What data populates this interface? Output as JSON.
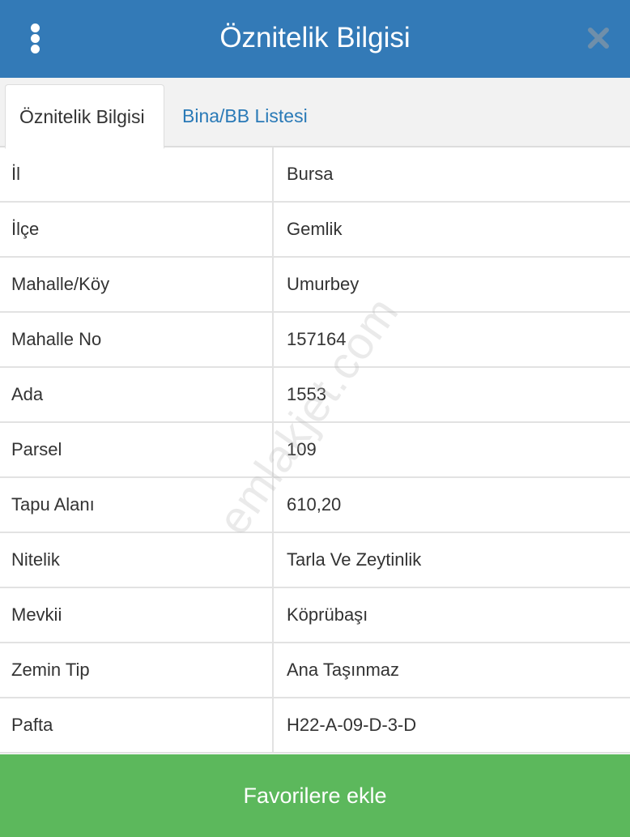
{
  "header": {
    "title": "Öznitelik Bilgisi",
    "menu_icon": "more-vertical-icon",
    "close_icon": "close-icon",
    "color": "#337ab7"
  },
  "tabs": [
    {
      "label": "Öznitelik Bilgisi",
      "active": true
    },
    {
      "label": "Bina/BB Listesi",
      "active": false
    }
  ],
  "attributes": [
    {
      "label": "İl",
      "value": "Bursa"
    },
    {
      "label": "İlçe",
      "value": "Gemlik"
    },
    {
      "label": "Mahalle/Köy",
      "value": "Umurbey"
    },
    {
      "label": "Mahalle No",
      "value": "157164"
    },
    {
      "label": "Ada",
      "value": "1553"
    },
    {
      "label": "Parsel",
      "value": "109"
    },
    {
      "label": "Tapu Alanı",
      "value": "610,20"
    },
    {
      "label": "Nitelik",
      "value": "Tarla Ve Zeytinlik"
    },
    {
      "label": "Mevkii",
      "value": "Köprübaşı"
    },
    {
      "label": "Zemin Tip",
      "value": "Ana Taşınmaz"
    },
    {
      "label": "Pafta",
      "value": "H22-A-09-D-3-D"
    }
  ],
  "watermark": "emlakjet.com",
  "footer": {
    "button_label": "Favorilere ekle",
    "color": "#5cb85c"
  }
}
